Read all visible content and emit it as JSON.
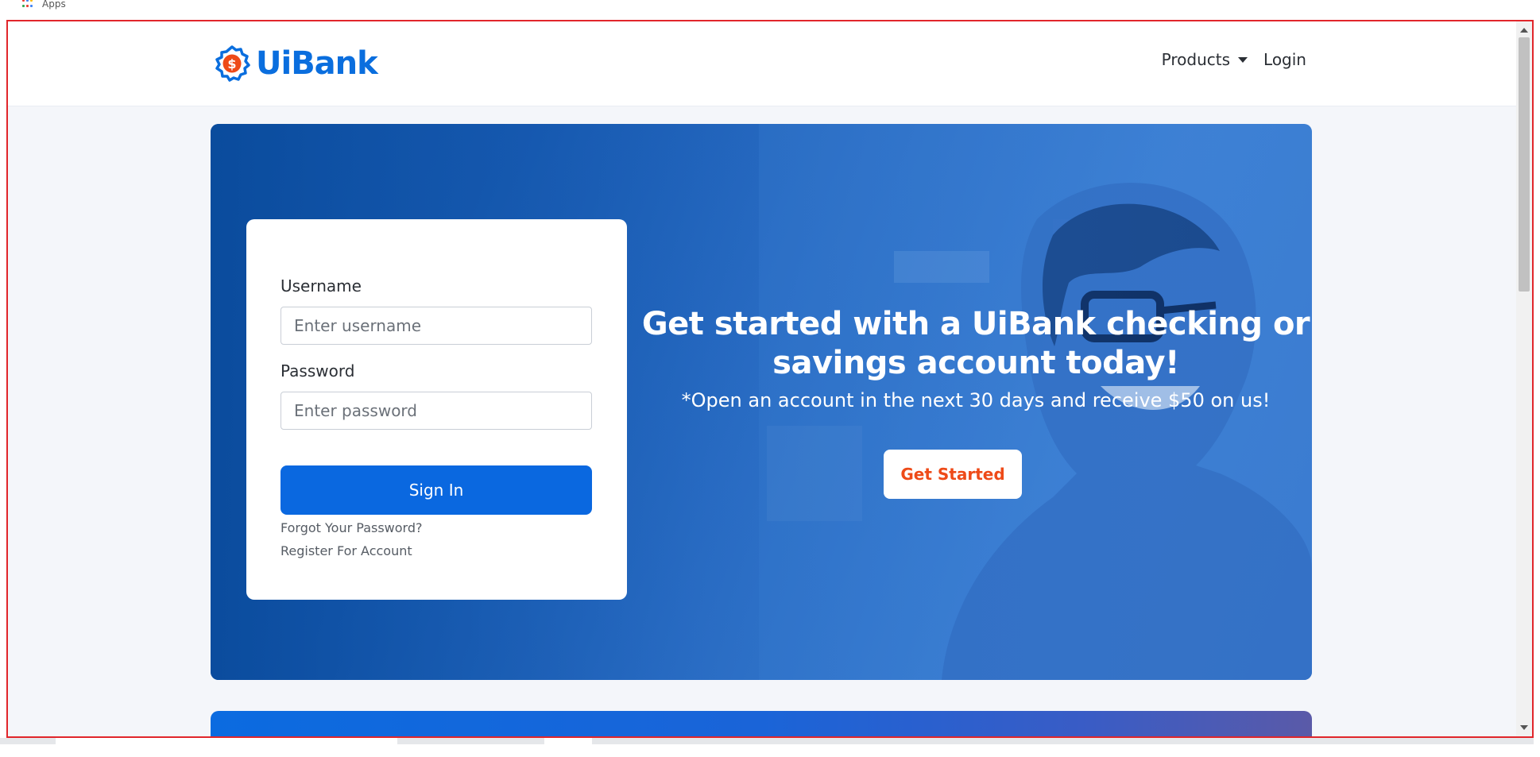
{
  "browser": {
    "bookmark_apps_label": "Apps"
  },
  "nav": {
    "brand_name": "UiBank",
    "brand_symbol": "$",
    "products_label": "Products",
    "login_label": "Login"
  },
  "login_form": {
    "username_label": "Username",
    "username_placeholder": "Enter username",
    "password_label": "Password",
    "password_placeholder": "Enter password",
    "signin_label": "Sign In",
    "forgot_label": "Forgot Your Password?",
    "register_label": "Register For Account"
  },
  "hero": {
    "title": "Get started with a UiBank checking or savings account today!",
    "subtitle": "*Open an account in the next 30 days and receive $50 on us!",
    "cta_label": "Get Started"
  },
  "colors": {
    "brand_blue": "#0a6ede",
    "primary_button": "#0a68e0",
    "cta_text": "#ee4a18",
    "logo_accent": "#ee4a18",
    "viewport_border": "#e1262b"
  },
  "icons": {
    "apps": "apps-grid-icon",
    "logo": "dollar-badge-icon",
    "dropdown": "caret-down-icon"
  }
}
